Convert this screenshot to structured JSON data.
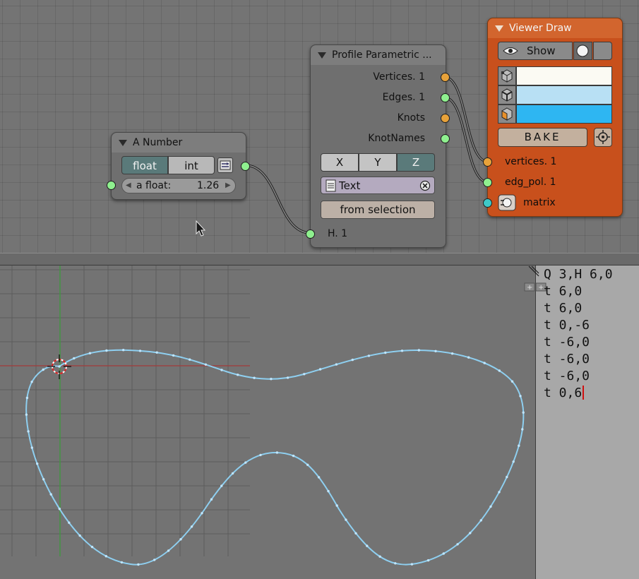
{
  "node_editor": {
    "nodes": {
      "number": {
        "title": "A Number",
        "modes": [
          "float",
          "int"
        ],
        "selected_mode": "float",
        "field_label": "a float:",
        "field_value": "1.26"
      },
      "profile": {
        "title": "Profile Parametric ...",
        "outputs": [
          "Vertices. 1",
          "Edges. 1",
          "Knots",
          "KnotNames"
        ],
        "axes": [
          "X",
          "Y",
          "Z"
        ],
        "selected_axis": "Z",
        "text_block": "Text",
        "from_selection_label": "from selection",
        "input_label": "H. 1"
      },
      "viewer": {
        "title": "Viewer Draw",
        "show_label": "Show",
        "bake_label": "BAKE",
        "inputs": [
          "vertices. 1",
          "edg_pol. 1",
          "matrix"
        ],
        "swatch_colors": [
          "#fbfaf3",
          "#b8e0f4",
          "#2eb6f2"
        ]
      }
    },
    "colors": {
      "socket_vertices": "#e8a23a",
      "socket_edges": "#8ff08f",
      "socket_matrix": "#3ec8c8",
      "viewer_node": "#c8501c"
    }
  },
  "text_editor": {
    "lines": [
      "Q 3,H 6,0",
      "t 6,0",
      "t 6,0",
      "t 0,-6",
      "t -6,0",
      "t -6,0",
      "t -6,0",
      "t 0,6"
    ]
  }
}
